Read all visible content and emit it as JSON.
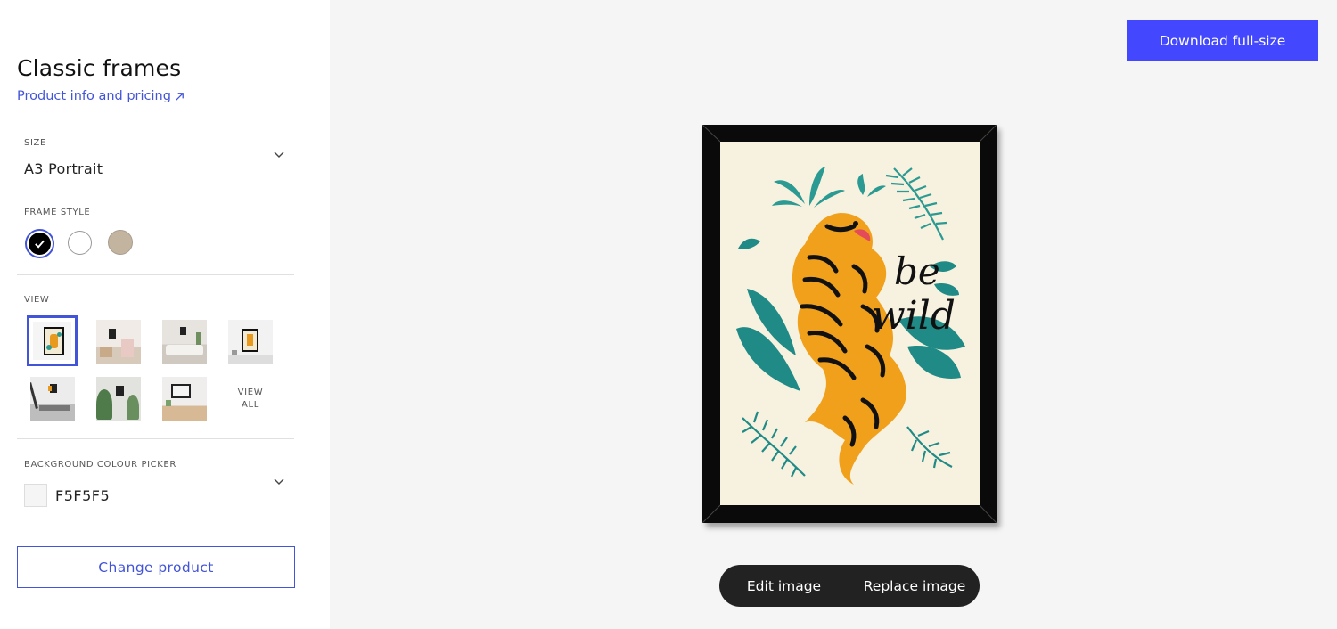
{
  "sidebar": {
    "title": "Classic frames",
    "info_link": "Product info and pricing",
    "size": {
      "label": "SIZE",
      "value": "A3 Portrait"
    },
    "frame_style": {
      "label": "FRAME STYLE",
      "options": [
        {
          "name": "black",
          "color": "#000000",
          "selected": true
        },
        {
          "name": "white",
          "color": "#ffffff",
          "selected": false
        },
        {
          "name": "natural",
          "color": "#c3b4a0",
          "selected": false
        }
      ]
    },
    "view": {
      "label": "VIEW",
      "view_all": [
        "VIEW",
        "ALL"
      ],
      "selected_index": 0
    },
    "background": {
      "label": "BACKGROUND COLOUR PICKER",
      "value": "F5F5F5",
      "color": "#f5f5f5"
    },
    "change_product": "Change product"
  },
  "toolbar": {
    "download": "Download full-size",
    "edit_image": "Edit image",
    "replace_image": "Replace image"
  },
  "colors": {
    "accent": "#4254d8",
    "download_button": "#4348ff",
    "canvas_background": "#f5f5f5",
    "frame": "#0a0a0a"
  },
  "artwork": {
    "lettering": [
      "be",
      "wild"
    ]
  }
}
